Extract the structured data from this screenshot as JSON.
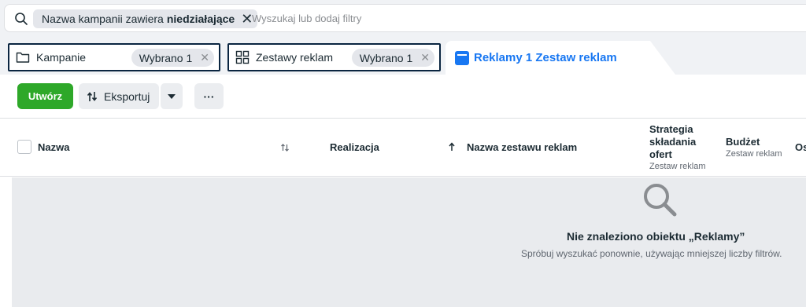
{
  "search": {
    "chip_prefix": "Nazwa kampanii zawiera",
    "chip_value": "niedziałające",
    "placeholder": "Wyszukaj lub dodaj filtry"
  },
  "tabs": {
    "campaigns": {
      "label": "Kampanie",
      "selected": "Wybrano 1"
    },
    "adsets": {
      "label": "Zestawy reklam",
      "selected": "Wybrano 1"
    },
    "ads": {
      "label": "Reklamy 1 Zestaw reklam"
    }
  },
  "toolbar": {
    "create_label": "Utwórz",
    "export_label": "Eksportuj",
    "more_label": "···"
  },
  "table": {
    "columns": {
      "name": "Nazwa",
      "delivery": "Realizacja",
      "adset_name": "Nazwa zestawu reklam",
      "bid_strategy_l1": "Strategia",
      "bid_strategy_l2": "składania",
      "bid_strategy_l3": "ofert",
      "bid_strategy_sub": "Zestaw reklam",
      "budget": "Budżet",
      "budget_sub": "Zestaw reklam",
      "cut": "Os"
    }
  },
  "empty_state": {
    "title": "Nie znaleziono obiektu „Reklamy”",
    "subtitle": "Spróbuj wyszukać ponownie, używając mniejszej liczby filtrów."
  },
  "colors": {
    "accent": "#1877f2",
    "create": "#2ea829",
    "tab_border": "#0a2540"
  }
}
